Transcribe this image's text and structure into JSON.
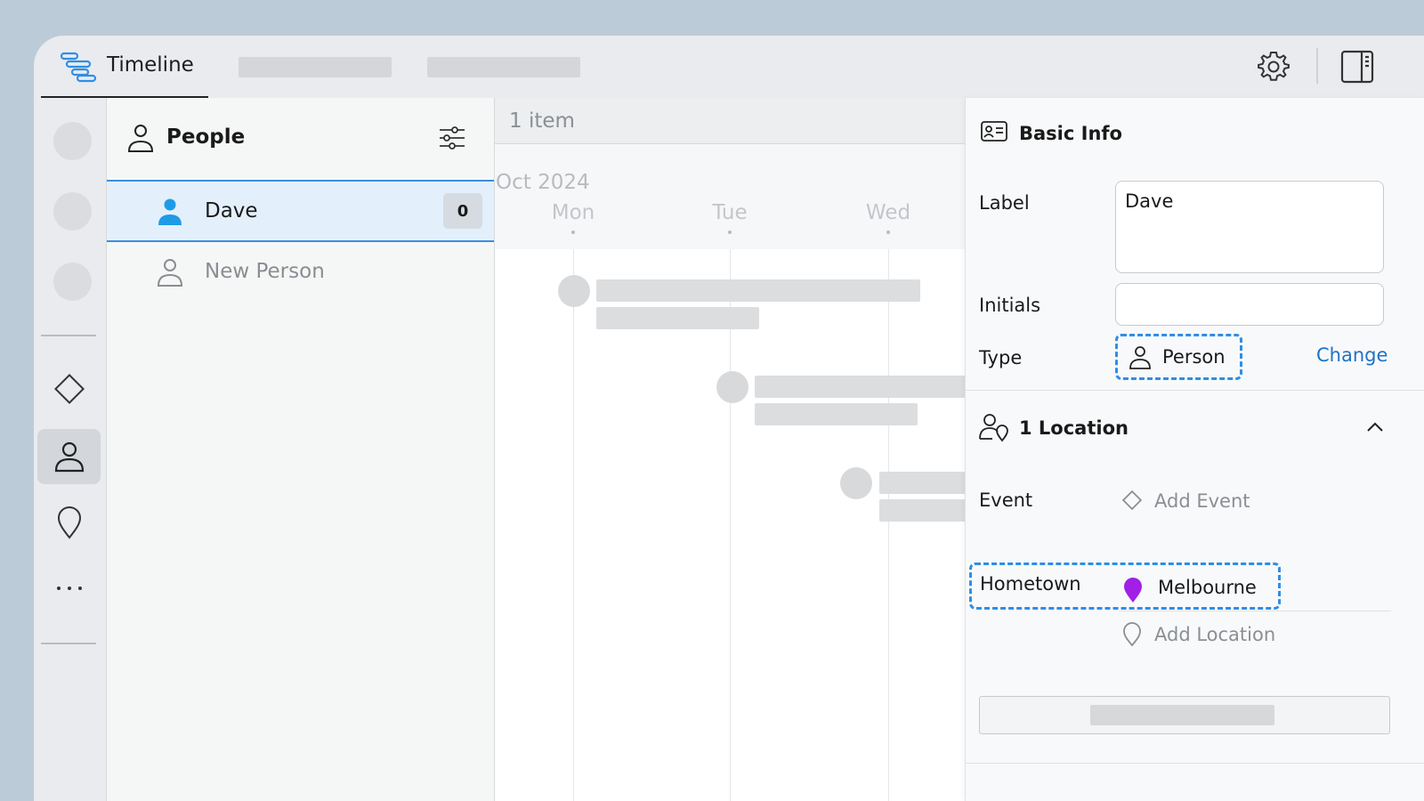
{
  "top_bar": {
    "active_tab_label": "Timeline"
  },
  "people_panel": {
    "title": "People",
    "items": [
      {
        "name": "Dave",
        "count": "0",
        "selected": true
      },
      {
        "name": "New Person",
        "selected": false
      }
    ]
  },
  "timeline": {
    "item_count": "1 item",
    "month": "Oct 2024",
    "days": [
      "Mon",
      "Tue",
      "Wed"
    ]
  },
  "inspector": {
    "basic_info_title": "Basic Info",
    "label_field": {
      "label": "Label",
      "value": "Dave"
    },
    "initials_field": {
      "label": "Initials",
      "value": ""
    },
    "type_field": {
      "label": "Type",
      "value": "Person",
      "action": "Change"
    },
    "locations_section": {
      "title": "1 Location",
      "event_label": "Event",
      "add_event": "Add Event",
      "hometown_label": "Hometown",
      "hometown_value": "Melbourne",
      "hometown_pin_color": "#a21fe6",
      "add_location": "Add Location"
    }
  },
  "colors": {
    "accent_blue": "#2f8ee6",
    "selection_bg": "#e3f0fc",
    "link": "#1f72c7"
  }
}
